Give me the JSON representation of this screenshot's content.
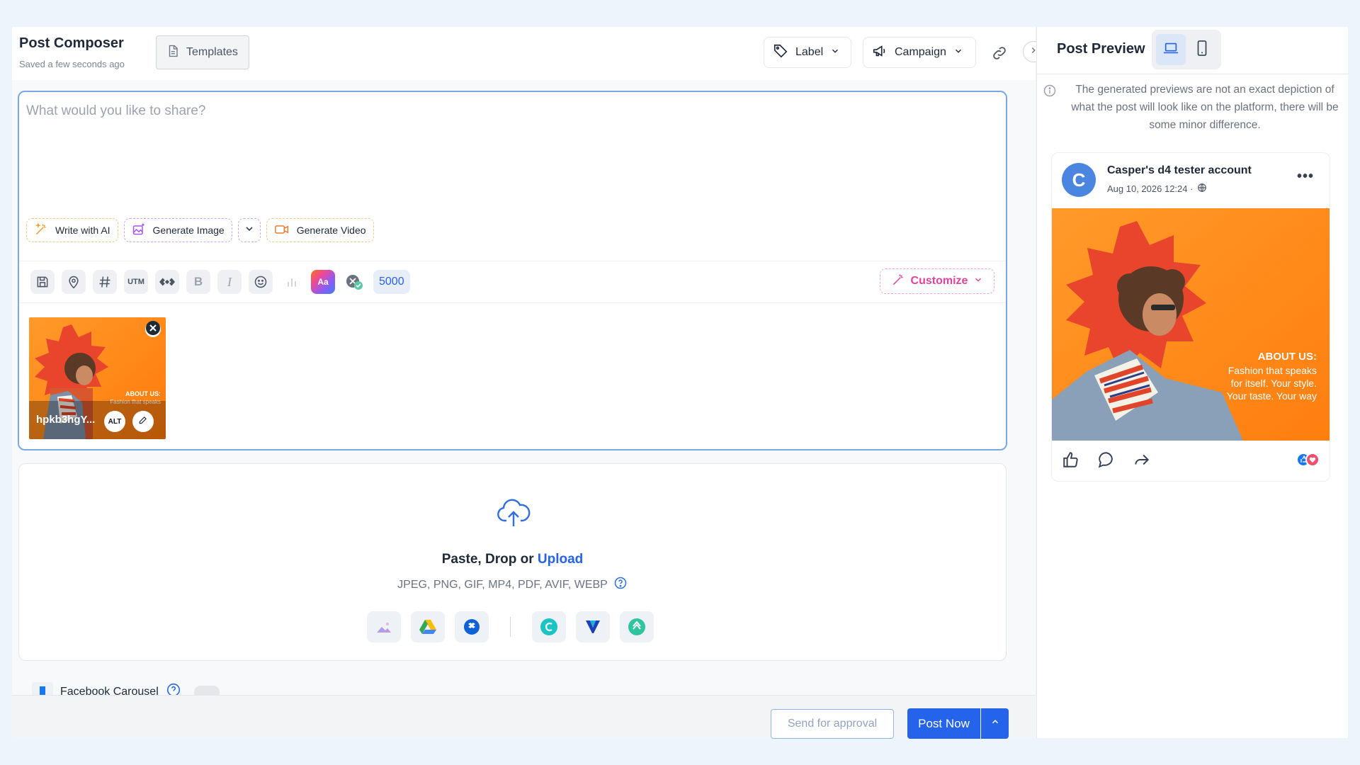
{
  "composer": {
    "title": "Post Composer",
    "saved_status": "Saved a few seconds ago",
    "templates_label": "Templates",
    "label_button": "Label",
    "campaign_button": "Campaign",
    "editor_placeholder": "What would you like to share?",
    "ai_buttons": {
      "write": "Write with AI",
      "image": "Generate Image",
      "video": "Generate Video"
    },
    "toolbar": {
      "utm": "UTM",
      "bold": "B",
      "italic": "I",
      "char_count": "5000",
      "customize": "Customize"
    },
    "attachment": {
      "file_name": "hpkb3hgY...",
      "alt_label": "ALT",
      "overlay_heading": "ABOUT US:",
      "overlay_text": "Fashion that speaks"
    },
    "dropzone": {
      "prefix": "Paste, Drop or ",
      "upload_link": "Upload",
      "formats": "JPEG, PNG, GIF, MP4, PDF, AVIF, WEBP"
    },
    "facebook_carousel_label": "Facebook Carousel",
    "send_approval": "Send for approval",
    "post_now": "Post Now"
  },
  "preview": {
    "title": "Post Preview",
    "note": "The generated previews are not an exact depiction of what the post will look like on the platform, there will be some minor difference.",
    "card": {
      "avatar_letter": "C",
      "account_name": "Casper's d4 tester account",
      "date": "Aug 10, 2026 12:24 ·",
      "image_heading": "ABOUT US:",
      "image_line1": "Fashion that speaks",
      "image_line2": "for itself. Your style.",
      "image_line3": "Your taste. Your way"
    }
  },
  "colors": {
    "accent": "#2563eb",
    "image_orange": "#ff8a1a",
    "starburst_red": "#e8452c",
    "customize_pink": "#e0449b",
    "avatar_blue": "#4a86e0"
  },
  "icons": [
    "document-icon",
    "tag-icon",
    "megaphone-icon",
    "link-icon",
    "chevron-right-icon",
    "save-icon",
    "location-icon",
    "hashtag-icon",
    "utm-icon",
    "link-shortener-icon",
    "bold-icon",
    "italic-icon",
    "emoji-icon",
    "chart-icon",
    "font-style-icon",
    "twitter-x-icon",
    "magic-wand-icon",
    "close-icon",
    "edit-icon",
    "cloud-upload-icon",
    "help-icon",
    "media-library-icon",
    "google-drive-icon",
    "dropbox-icon",
    "canva-icon",
    "vistacreate-icon",
    "postnitro-icon",
    "laptop-icon",
    "mobile-icon",
    "info-icon",
    "globe-icon",
    "more-icon",
    "like-icon",
    "comment-icon",
    "share-icon",
    "chevron-up-icon"
  ]
}
